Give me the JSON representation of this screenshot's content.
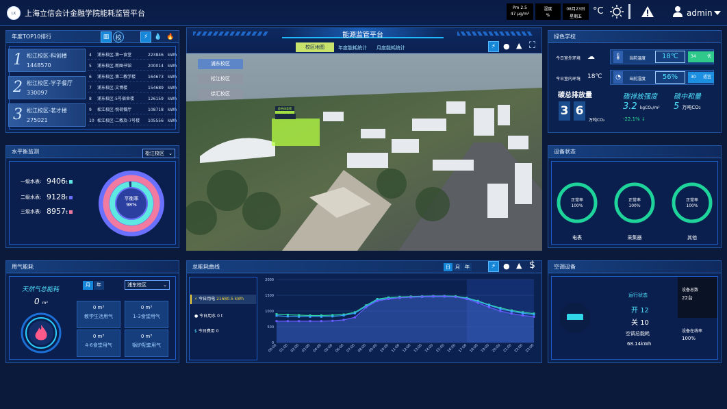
{
  "header": {
    "title": "上海立信会计金融学院能耗监管平台",
    "pm_label": "Pm 2.5",
    "pm_value": "47 μg/m³",
    "humidity_label": "湿度",
    "humidity_value": "%",
    "date": "08月23日",
    "weekday": "星期五",
    "temp_unit": "°C",
    "user": "admin"
  },
  "center": {
    "title": "能源监管平台",
    "tabs": [
      "校区地图",
      "年度能耗统计",
      "月度能耗统计"
    ],
    "campus_buttons": [
      "浦东校区",
      "松江校区",
      "徐汇校区"
    ],
    "building_marker": "综合体育馆"
  },
  "top10": {
    "title": "年度TOP10排行",
    "cards": [
      {
        "rank": "1",
        "name": "松江校区-科创楼",
        "value": "1448570"
      },
      {
        "rank": "2",
        "name": "松江校区-学子餐厅",
        "value": "330097"
      },
      {
        "rank": "3",
        "name": "松江校区-茗才楼",
        "value": "275021"
      }
    ],
    "rows": [
      {
        "rank": "4",
        "name": "浦东校区-第一食堂",
        "value": "223846",
        "unit": "kWh"
      },
      {
        "rank": "5",
        "name": "浦东校区-新图书馆",
        "value": "200014",
        "unit": "kWh"
      },
      {
        "rank": "6",
        "name": "浦东校区-第二教学楼",
        "value": "164673",
        "unit": "kWh"
      },
      {
        "rank": "7",
        "name": "浦东校区-文博楼",
        "value": "154689",
        "unit": "kWh"
      },
      {
        "rank": "8",
        "name": "浦东校区-5号宿舍楼",
        "value": "126159",
        "unit": "kWh"
      },
      {
        "rank": "9",
        "name": "松江校区-悦荷餐厅",
        "value": "108718",
        "unit": "kWh"
      },
      {
        "rank": "10",
        "name": "松江校区-二教及-7号楼",
        "value": "105556",
        "unit": "kWh"
      }
    ]
  },
  "water": {
    "title": "水平衡监测",
    "select": "松江校区",
    "level1_label": "一级水表:",
    "level1_value": "9406",
    "level1_unit": "t",
    "level2_label": "二级水表:",
    "level2_value": "9128",
    "level2_unit": "t",
    "level3_label": "三级水表:",
    "level3_value": "8957",
    "level3_unit": "t",
    "ring_label": "平衡率",
    "ring_value": "98%",
    "ring_fraction": 0.98
  },
  "gas": {
    "title": "用气能耗",
    "subtitle": "天然气总能耗",
    "total": "0",
    "total_unit": "m³",
    "tab_month": "月",
    "tab_year": "年",
    "select": "浦东校区",
    "items": [
      {
        "value": "0 m³",
        "label": "教学生活用气"
      },
      {
        "value": "0 m³",
        "label": "1-3食堂用气"
      },
      {
        "value": "0 m³",
        "label": "4-6食堂用气"
      },
      {
        "value": "0 m³",
        "label": "锅炉配套用气"
      }
    ]
  },
  "curve": {
    "title": "总能耗曲线",
    "tabs": [
      "日",
      "月",
      "年"
    ],
    "today_elec_label": "今日用电",
    "today_elec_value": "21680.5 kWh",
    "today_water_label": "今日用水",
    "today_water_value": "0 t",
    "today_cost_label": "今日费用",
    "today_cost_value": "0"
  },
  "chart_data": {
    "type": "line",
    "x": [
      "00:00",
      "01:00",
      "02:00",
      "03:00",
      "04:00",
      "05:00",
      "06:00",
      "07:00",
      "08:00",
      "09:00",
      "10:00",
      "11:00",
      "12:00",
      "13:00",
      "14:00",
      "15:00",
      "16:00",
      "17:00",
      "18:00",
      "19:00",
      "20:00",
      "21:00",
      "22:00",
      "23:00"
    ],
    "series": [
      {
        "values": [
          900,
          880,
          870,
          860,
          860,
          870,
          890,
          960,
          1180,
          1380,
          1430,
          1450,
          1460,
          1470,
          1480,
          1480,
          1470,
          1420,
          1320,
          1200,
          1100,
          1020,
          960,
          920
        ]
      },
      {
        "values": [
          850,
          830,
          820,
          820,
          820,
          830,
          860,
          930,
          1150,
          1350,
          1400,
          1420,
          1440,
          1450,
          1460,
          1460,
          1450,
          1400,
          1300,
          1180,
          1070,
          990,
          930,
          890
        ]
      },
      {
        "values": [
          680,
          680,
          680,
          680,
          680,
          690,
          720,
          800,
          1120,
          1320,
          1380,
          1420,
          1440,
          1460,
          1470,
          1470,
          1450,
          1380,
          1260,
          1120,
          1000,
          920,
          860,
          820
        ]
      }
    ],
    "ylim": [
      0,
      2000
    ],
    "yticks": [
      0,
      500,
      1000,
      1500,
      2000
    ],
    "grid": true,
    "colors": [
      "#2fd7a0",
      "#3aa6ff",
      "#6a5cff"
    ]
  },
  "green": {
    "title": "绿色学校",
    "outdoor_label": "今日室外环境",
    "indoor_label": "今日室内环境",
    "indoor_temp": "18℃",
    "cur_temp_label": "当前温度",
    "cur_temp": "18℃",
    "badge1_num": "34",
    "badge1_text": "优",
    "cur_hum_label": "当前湿度",
    "cur_hum": "56%",
    "badge2_num": "30",
    "badge2_text": "适宜",
    "carbon_label": "碳总排放量",
    "carbon_digits": [
      "3",
      "6"
    ],
    "carbon_unit": "万吨CO₂",
    "intensity_label": "碳排放强度",
    "intensity_value": "3.2",
    "intensity_unit": "kgCO₂/m²",
    "intensity_change": "-22.1%",
    "neutral_label": "碳中和量",
    "neutral_value": "5",
    "neutral_unit": "万吨CO₂"
  },
  "devices": {
    "title": "设备状态",
    "items": [
      {
        "status": "正常率",
        "rate": "100%",
        "label": "电表",
        "fraction": 1.0
      },
      {
        "status": "正常率",
        "rate": "100%",
        "label": "采集器",
        "fraction": 1.0
      },
      {
        "status": "正常率",
        "rate": "100%",
        "label": "其他",
        "fraction": 1.0
      }
    ]
  },
  "ac": {
    "title": "空调设备",
    "run_label": "运行状态",
    "on_label": "开",
    "on_value": "12",
    "off_label": "关",
    "off_value": "10",
    "energy_label": "空调总能耗",
    "energy_value": "68.14kWh",
    "total_label": "设备总数",
    "total_value": "22台",
    "online_label": "设备在线率",
    "online_value": "100%"
  },
  "colors": {
    "accent": "#4fe3ff",
    "ring_pink": "#f07aa0",
    "ring_blue": "#6a70ff",
    "ring_teal": "#5fe7e2",
    "device_ring": "#1ed49a"
  }
}
